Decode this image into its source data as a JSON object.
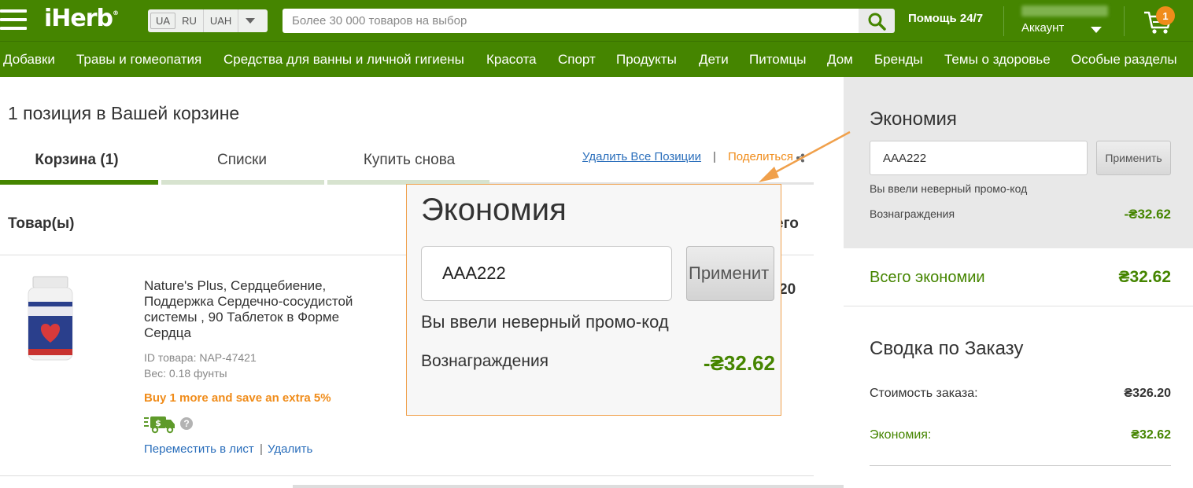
{
  "header": {
    "logo": "iHerb",
    "locale": {
      "country": "UA",
      "language": "RU",
      "currency": "UAH"
    },
    "search_placeholder": "Более 30 000 товаров на выбор",
    "help": "Помощь 24/7",
    "account_label": "Аккаунт",
    "cart_count": "1"
  },
  "categories": [
    "Добавки",
    "Травы и гомеопатия",
    "Средства для ванны и личной гигиены",
    "Красота",
    "Спорт",
    "Продукты",
    "Дети",
    "Питомцы",
    "Дом",
    "Бренды",
    "Темы о здоровье",
    "Особые разделы"
  ],
  "cart": {
    "title": "1 позиция в Вашей корзине",
    "tabs": [
      "Корзина (1)",
      "Списки",
      "Купить снова"
    ],
    "delete_all": "Удалить Все Позиции",
    "separator": "|",
    "share": "Поделиться",
    "col_product": "Товар(ы)",
    "col_total": "его",
    "item": {
      "name": "Nature's Plus, Сердцебиение, Поддержка Сердечно-сосудистой системы , 90 Таблеток в Форме Сердца",
      "id": "ID товара: NAP-47421",
      "weight": "Вес: 0.18 фунты",
      "promo": "Buy 1 more and save an extra 5%",
      "help_mark": "?",
      "move_link": "Переместить в лист",
      "link_sep": "|",
      "delete_link": "Удалить",
      "price_fragment": "20"
    }
  },
  "sidebar": {
    "savings_title": "Экономия",
    "coupon_value": "AAA222",
    "apply_label": "Применить",
    "error_text": "Вы ввели неверный промо-код",
    "rewards_label": "Вознаграждения",
    "rewards_value": "-₴32.62",
    "total_savings_label": "Всего экономии",
    "total_savings_value": "₴32.62",
    "summary_title": "Сводка по Заказу",
    "order_cost_label": "Стоимость заказа:",
    "order_cost_value": "₴326.20",
    "savings_label": "Экономия:",
    "savings_value": "₴32.62"
  },
  "zoom": {
    "title": "Экономия",
    "coupon_value": "AAA222",
    "apply_label": "Применит",
    "error_text": "Вы ввели неверный промо-код",
    "rewards_label": "Вознаграждения",
    "rewards_value": "-₴32.62"
  },
  "colors": {
    "brand_green": "#458500",
    "accent_orange": "#f08c1a",
    "link_blue": "#2a6ebb"
  }
}
